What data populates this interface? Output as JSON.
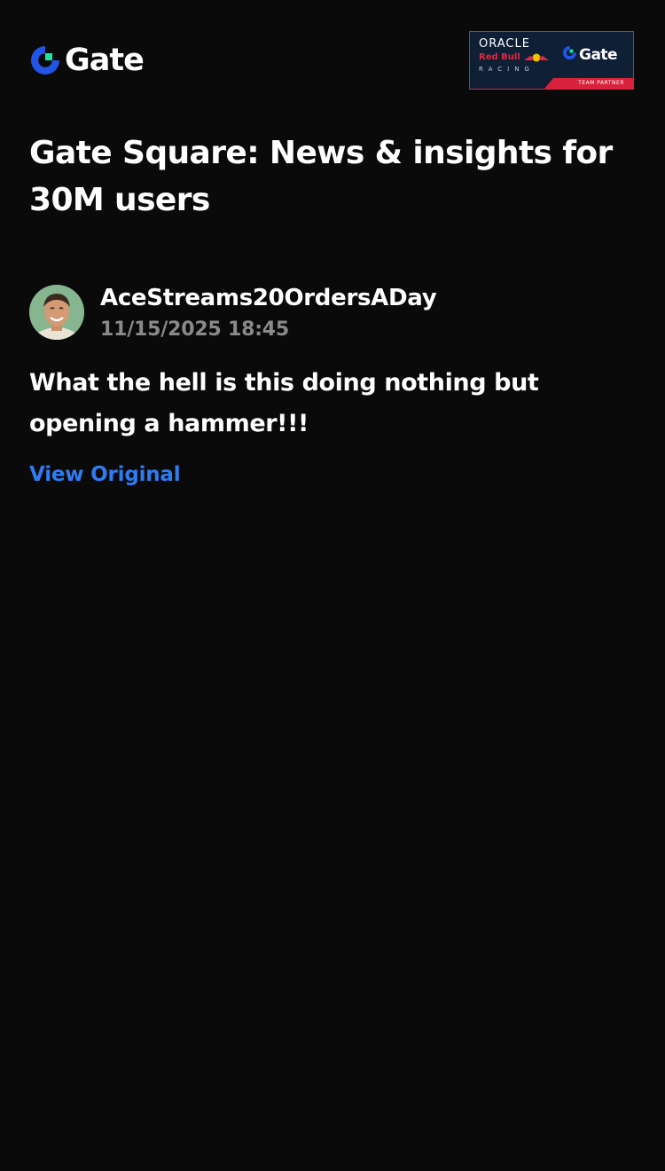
{
  "header": {
    "brand_name": "Gate",
    "brand_icon": "gate-logo-icon",
    "partner_badge": {
      "line1": "ORACLE",
      "line2": "Red Bull",
      "line3": "RACING",
      "brand": "Gate",
      "caption": "TEAM PARTNER"
    }
  },
  "page": {
    "title": "Gate Square: News & insights for 30M users"
  },
  "post": {
    "author": "AceStreams20OrdersADay",
    "timestamp": "11/15/2025 18:45",
    "body": "What the hell is this doing nothing but opening a hammer!!!",
    "view_original_label": "View Original"
  },
  "colors": {
    "background": "#0a0a0a",
    "brand_blue": "#2354e6",
    "brand_green": "#17e6a1",
    "link_blue": "#2f7bf0",
    "muted_text": "#8a8a8a",
    "badge_navy": "#0f1f36",
    "badge_red": "#d8213b"
  }
}
